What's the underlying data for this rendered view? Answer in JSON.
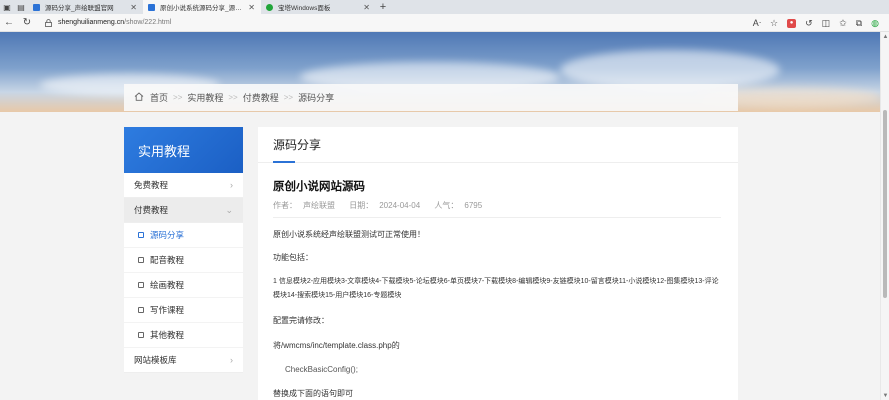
{
  "browser": {
    "tabs": [
      {
        "label": "源码分享_声绘联盟官网",
        "active": false,
        "icon_color": "#2b72d6"
      },
      {
        "label": "原创小说系统源码分享_源码分享",
        "active": true,
        "icon_color": "#2b72d6"
      },
      {
        "label": "宝塔Windows面板",
        "active": false,
        "icon_color": "#20a53a"
      }
    ],
    "url_host": "shenghuilianmeng.cn",
    "url_path": "/show/222.html"
  },
  "breadcrumb": {
    "items": [
      "首页",
      "实用教程",
      "付费教程",
      "源码分享"
    ],
    "separator": ">>"
  },
  "sidebar": {
    "title": "实用教程",
    "items": [
      {
        "label": "免费教程"
      },
      {
        "label": "付费教程"
      },
      {
        "label": "网站模板库"
      }
    ],
    "subitems": [
      {
        "label": "源码分享"
      },
      {
        "label": "配音教程"
      },
      {
        "label": "绘画教程"
      },
      {
        "label": "写作课程"
      },
      {
        "label": "其他教程"
      }
    ]
  },
  "article": {
    "section": "源码分享",
    "title": "原创小说网站源码",
    "author_label": "作者：",
    "author": "声绘联盟",
    "date_label": "日期：",
    "date": "2024-04-04",
    "views_label": "人气：",
    "views": "6795",
    "paragraphs": [
      "原创小说系统经声绘联盟测试可正常使用！",
      "功能包括：",
      "1 信息模块2-应用模块3-文章模块4-下载模块5-论坛模块6-单页模块7-下载模块8-编辑模块9-友链模块10-留言模块11-小说模块12-图集模块13-评论模块14-搜索模块15-用户模块16-专题模块",
      "配置完请修改：",
      "将/wmcms/inc/template.class.php的",
      "CheckBasicConfig();",
      "替换成下面的语句即可"
    ]
  },
  "colors": {
    "accent": "#2b72d6",
    "sidebar_header": "#1f66cf"
  }
}
